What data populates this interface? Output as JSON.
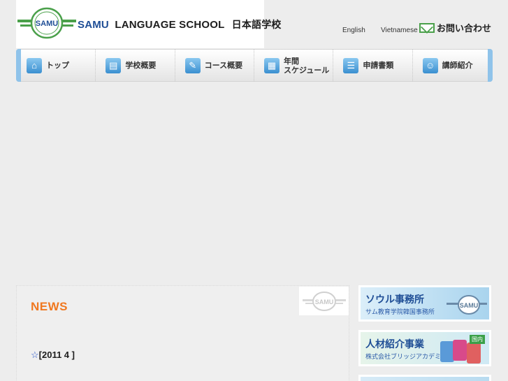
{
  "header": {
    "logo_word": "SAMU",
    "school_name": "LANGUAGE SCHOOL",
    "school_name_jp": "日本語学校",
    "emblem_text": "SAMU",
    "lang_english": "English",
    "lang_vietnamese": "Vietnamese",
    "contact_label": "お問い合わせ"
  },
  "nav": {
    "items": [
      {
        "label": "トップ",
        "icon": "home-icon",
        "glyph": "⌂"
      },
      {
        "label": "学校概要",
        "icon": "document-icon",
        "glyph": "▤"
      },
      {
        "label": "コース概要",
        "icon": "teacher-icon",
        "glyph": "✎"
      },
      {
        "label": "年間\nスケジュール",
        "icon": "calendar-icon",
        "glyph": "▦"
      },
      {
        "label": "申請書類",
        "icon": "form-icon",
        "glyph": "☰"
      },
      {
        "label": "講師紹介",
        "icon": "instructor-icon",
        "glyph": "☺"
      }
    ]
  },
  "news": {
    "title": "NEWS",
    "badge_text": "SAMU",
    "first_line_star": "☆",
    "first_line": "[2011  4          ]"
  },
  "sidebar": {
    "banners": [
      {
        "title": "ソウル事務所",
        "subtitle": "サム教育学院韓国事務所",
        "logo_text": "SAMU"
      },
      {
        "title": "人材紹介事業",
        "subtitle": "株式会社ブリッジアカデミー",
        "badge": "国内"
      }
    ]
  },
  "colors": {
    "brand_blue": "#1f4e96",
    "brand_green": "#4aa04a",
    "news_orange": "#f07820",
    "nav_accent": "#8fc3ea"
  }
}
